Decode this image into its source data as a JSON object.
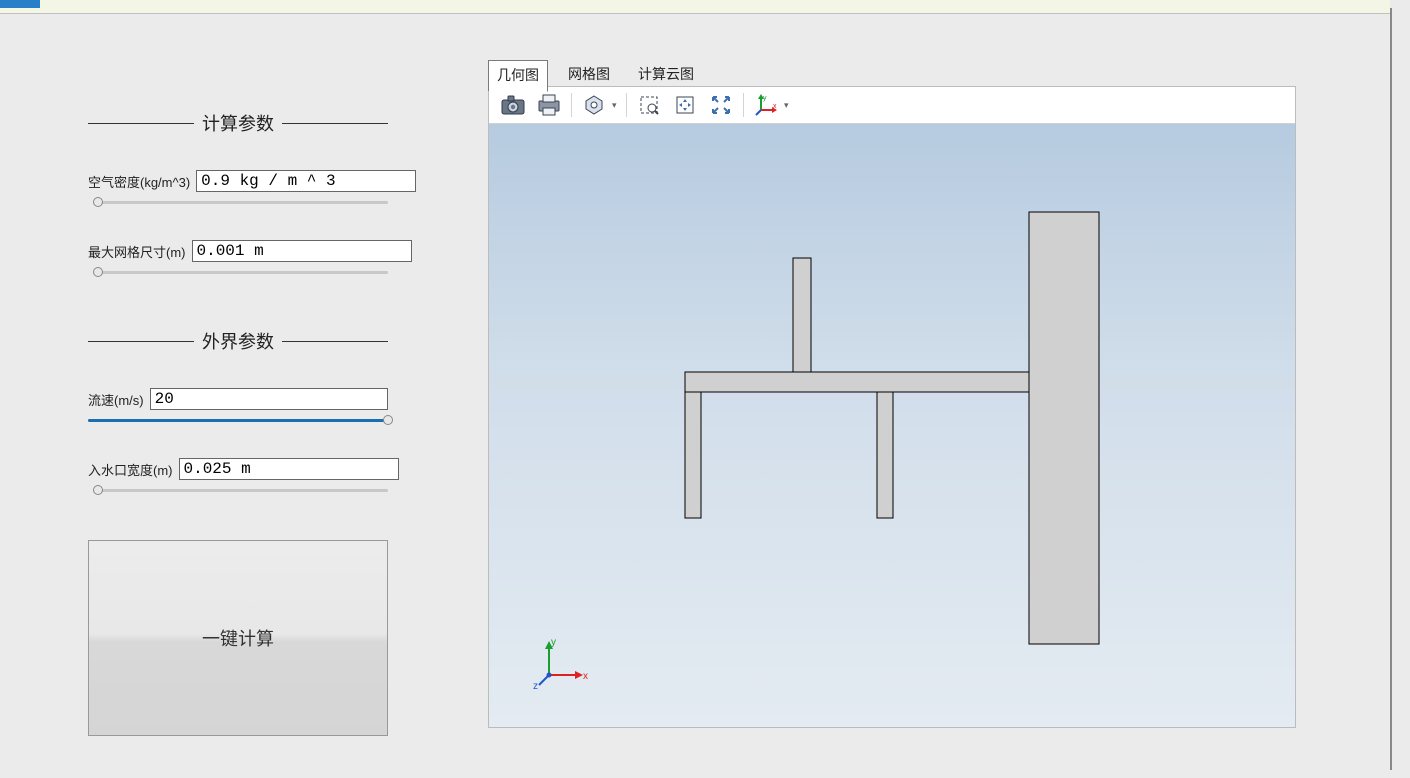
{
  "sections": {
    "calc_params_title": "计算参数",
    "external_params_title": "外界参数"
  },
  "params": {
    "air_density": {
      "label": "空气密度(kg/m^3)",
      "value": "0.9 kg / m ^ 3",
      "slider_pct": 0
    },
    "max_mesh": {
      "label": "最大网格尺寸(m)",
      "value": "0.001 m",
      "slider_pct": 0
    },
    "flow_speed": {
      "label": "流速(m/s)",
      "value": "20",
      "slider_pct": 100
    },
    "inlet_width": {
      "label": "入水口宽度(m)",
      "value": "0.025 m",
      "slider_pct": 0
    }
  },
  "buttons": {
    "compute": "一键计算"
  },
  "tabs": {
    "geometry": "几何图",
    "mesh": "网格图",
    "result": "计算云图",
    "active": "geometry"
  },
  "toolbar_icons": {
    "camera": "camera-icon",
    "print": "print-icon",
    "settings": "hexagon-icon",
    "zoom_box": "zoom-box-icon",
    "pan": "pan-icon",
    "fit": "fit-view-icon",
    "axes": "axes-icon"
  },
  "axis_labels": {
    "x": "x",
    "y": "y",
    "z": "z"
  }
}
